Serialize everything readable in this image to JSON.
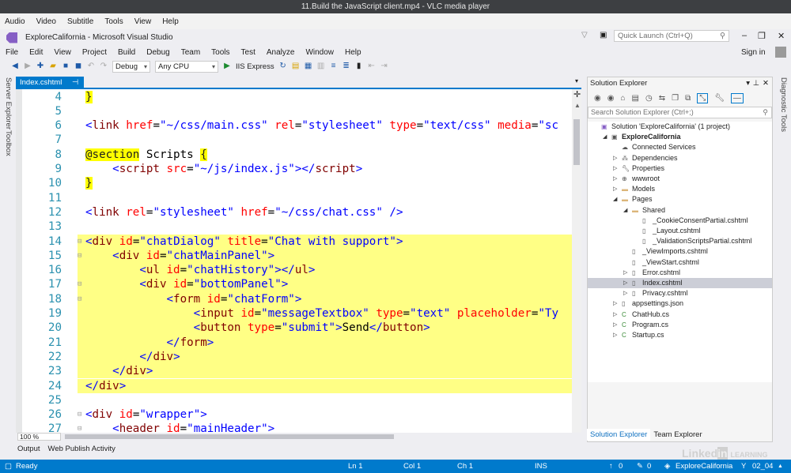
{
  "vlc": {
    "title": "11.Build the JavaScript client.mp4 - VLC media player",
    "menu": [
      "Audio",
      "Video",
      "Subtitle",
      "Tools",
      "View",
      "Help"
    ]
  },
  "vs": {
    "title": "ExploreCalifornia - Microsoft Visual Studio",
    "quick_launch_placeholder": "Quick Launch (Ctrl+Q)",
    "sign_in": "Sign in",
    "menu": [
      "File",
      "Edit",
      "View",
      "Project",
      "Build",
      "Debug",
      "Team",
      "Tools",
      "Test",
      "Analyze",
      "Window",
      "Help"
    ],
    "toolbar": {
      "config": "Debug",
      "platform": "Any CPU",
      "run": "IIS Express"
    }
  },
  "left_strip": [
    "Server Explorer",
    "Toolbox"
  ],
  "right_strip": [
    "Diagnostic Tools"
  ],
  "editor": {
    "tab": "Index.cshtml",
    "zoom": "100 %",
    "lines": [
      {
        "n": "4",
        "t": [
          [
            "br",
            "}"
          ]
        ]
      },
      {
        "n": "5",
        "t": []
      },
      {
        "n": "6",
        "t": [
          [
            "tag",
            "<"
          ],
          [
            "el",
            "link "
          ],
          [
            "at",
            "href"
          ],
          [
            "d",
            "="
          ],
          [
            "st",
            "\"~/css/main.css\" "
          ],
          [
            "at",
            "rel"
          ],
          [
            "d",
            "="
          ],
          [
            "st",
            "\"stylesheet\" "
          ],
          [
            "at",
            "type"
          ],
          [
            "d",
            "="
          ],
          [
            "st",
            "\"text/css\" "
          ],
          [
            "at",
            "media"
          ],
          [
            "d",
            "="
          ],
          [
            "st",
            "\"sc"
          ]
        ]
      },
      {
        "n": "7",
        "t": []
      },
      {
        "n": "8",
        "t": [
          [
            "br",
            "@section"
          ],
          [
            "d",
            " Scripts "
          ],
          [
            "br",
            "{"
          ]
        ]
      },
      {
        "n": "9",
        "t": [
          [
            "d",
            "    "
          ],
          [
            "tag",
            "<"
          ],
          [
            "el",
            "script "
          ],
          [
            "at",
            "src"
          ],
          [
            "d",
            "="
          ],
          [
            "st",
            "\"~/js/index.js\""
          ],
          [
            "tag",
            "></"
          ],
          [
            "el",
            "script"
          ],
          [
            "tag",
            ">"
          ]
        ]
      },
      {
        "n": "10",
        "t": [
          [
            "br",
            "}"
          ]
        ]
      },
      {
        "n": "11",
        "t": []
      },
      {
        "n": "12",
        "t": [
          [
            "tag",
            "<"
          ],
          [
            "el",
            "link "
          ],
          [
            "at",
            "rel"
          ],
          [
            "d",
            "="
          ],
          [
            "st",
            "\"stylesheet\" "
          ],
          [
            "at",
            "href"
          ],
          [
            "d",
            "="
          ],
          [
            "st",
            "\"~/css/chat.css\" "
          ],
          [
            "tag",
            "/>"
          ]
        ]
      },
      {
        "n": "13",
        "t": []
      },
      {
        "n": "14",
        "hl": true,
        "f": "⊟",
        "t": [
          [
            "tag",
            "<"
          ],
          [
            "el",
            "div "
          ],
          [
            "at",
            "id"
          ],
          [
            "d",
            "="
          ],
          [
            "st",
            "\"chatDialog\" "
          ],
          [
            "at",
            "title"
          ],
          [
            "d",
            "="
          ],
          [
            "st",
            "\"Chat with support\""
          ],
          [
            "tag",
            ">"
          ]
        ]
      },
      {
        "n": "15",
        "hl": true,
        "f": "⊟",
        "t": [
          [
            "d",
            "    "
          ],
          [
            "tag",
            "<"
          ],
          [
            "el",
            "div "
          ],
          [
            "at",
            "id"
          ],
          [
            "d",
            "="
          ],
          [
            "st",
            "\"chatMainPanel\""
          ],
          [
            "tag",
            ">"
          ]
        ]
      },
      {
        "n": "16",
        "hl": true,
        "t": [
          [
            "d",
            "        "
          ],
          [
            "tag",
            "<"
          ],
          [
            "el",
            "ul "
          ],
          [
            "at",
            "id"
          ],
          [
            "d",
            "="
          ],
          [
            "st",
            "\"chatHistory\""
          ],
          [
            "tag",
            "></"
          ],
          [
            "el",
            "ul"
          ],
          [
            "tag",
            ">"
          ]
        ]
      },
      {
        "n": "17",
        "hl": true,
        "f": "⊟",
        "t": [
          [
            "d",
            "        "
          ],
          [
            "tag",
            "<"
          ],
          [
            "el",
            "div "
          ],
          [
            "at",
            "id"
          ],
          [
            "d",
            "="
          ],
          [
            "st",
            "\"bottomPanel\""
          ],
          [
            "tag",
            ">"
          ]
        ]
      },
      {
        "n": "18",
        "hl": true,
        "f": "⊟",
        "t": [
          [
            "d",
            "            "
          ],
          [
            "tag",
            "<"
          ],
          [
            "el",
            "form "
          ],
          [
            "at",
            "id"
          ],
          [
            "d",
            "="
          ],
          [
            "st",
            "\"chatForm\""
          ],
          [
            "tag",
            ">"
          ]
        ]
      },
      {
        "n": "19",
        "hl": true,
        "t": [
          [
            "d",
            "                "
          ],
          [
            "tag",
            "<"
          ],
          [
            "el",
            "input "
          ],
          [
            "at",
            "id"
          ],
          [
            "d",
            "="
          ],
          [
            "st",
            "\"messageTextbox\" "
          ],
          [
            "at",
            "type"
          ],
          [
            "d",
            "="
          ],
          [
            "st",
            "\"text\" "
          ],
          [
            "at",
            "placeholder"
          ],
          [
            "d",
            "="
          ],
          [
            "st",
            "\"Ty"
          ]
        ]
      },
      {
        "n": "20",
        "hl": true,
        "t": [
          [
            "d",
            "                "
          ],
          [
            "tag",
            "<"
          ],
          [
            "el",
            "button "
          ],
          [
            "at",
            "type"
          ],
          [
            "d",
            "="
          ],
          [
            "st",
            "\"submit\""
          ],
          [
            "tag",
            ">"
          ],
          [
            "d",
            "Send"
          ],
          [
            "tag",
            "</"
          ],
          [
            "el",
            "button"
          ],
          [
            "tag",
            ">"
          ]
        ]
      },
      {
        "n": "21",
        "hl": true,
        "t": [
          [
            "d",
            "            "
          ],
          [
            "tag",
            "</"
          ],
          [
            "el",
            "form"
          ],
          [
            "tag",
            ">"
          ]
        ]
      },
      {
        "n": "22",
        "hl": true,
        "t": [
          [
            "d",
            "        "
          ],
          [
            "tag",
            "</"
          ],
          [
            "el",
            "div"
          ],
          [
            "tag",
            ">"
          ]
        ]
      },
      {
        "n": "23",
        "hl": true,
        "t": [
          [
            "d",
            "    "
          ],
          [
            "tag",
            "</"
          ],
          [
            "el",
            "div"
          ],
          [
            "tag",
            ">"
          ]
        ]
      },
      {
        "n": "24",
        "hl": true,
        "t": [
          [
            "tag",
            "</"
          ],
          [
            "el",
            "div"
          ],
          [
            "tag",
            ">"
          ]
        ]
      },
      {
        "n": "25",
        "t": []
      },
      {
        "n": "26",
        "f": "⊟",
        "t": [
          [
            "tag",
            "<"
          ],
          [
            "el",
            "div "
          ],
          [
            "at",
            "id"
          ],
          [
            "d",
            "="
          ],
          [
            "st",
            "\"wrapper\""
          ],
          [
            "tag",
            ">"
          ]
        ]
      },
      {
        "n": "27",
        "f": "⊟",
        "t": [
          [
            "d",
            "    "
          ],
          [
            "tag",
            "<"
          ],
          [
            "el",
            "header "
          ],
          [
            "at",
            "id"
          ],
          [
            "d",
            "="
          ],
          [
            "st",
            "\"mainHeader\""
          ],
          [
            "tag",
            ">"
          ]
        ]
      }
    ]
  },
  "output_tabs": [
    "Output",
    "Web Publish Activity"
  ],
  "solution_explorer": {
    "title": "Solution Explorer",
    "search_placeholder": "Search Solution Explorer (Ctrl+;)",
    "tree": [
      {
        "label": "Solution 'ExploreCalifornia' (1 project)",
        "depth": 0,
        "icon": "solution-icon"
      },
      {
        "label": "ExploreCalifornia",
        "depth": 1,
        "expanded": true,
        "bold": true,
        "icon": "project-icon"
      },
      {
        "label": "Connected Services",
        "depth": 2,
        "icon": "cloud-icon"
      },
      {
        "label": "Dependencies",
        "depth": 2,
        "expanded": false,
        "icon": "dependencies-icon"
      },
      {
        "label": "Properties",
        "depth": 2,
        "expanded": false,
        "icon": "wrench-icon"
      },
      {
        "label": "wwwroot",
        "depth": 2,
        "expanded": false,
        "icon": "globe-icon"
      },
      {
        "label": "Models",
        "depth": 2,
        "expanded": false,
        "icon": "folder-icon"
      },
      {
        "label": "Pages",
        "depth": 2,
        "expanded": true,
        "icon": "folder-icon"
      },
      {
        "label": "Shared",
        "depth": 3,
        "expanded": true,
        "icon": "folder-icon"
      },
      {
        "label": "_CookieConsentPartial.cshtml",
        "depth": 4,
        "icon": "file-icon"
      },
      {
        "label": "_Layout.cshtml",
        "depth": 4,
        "icon": "file-icon"
      },
      {
        "label": "_ValidationScriptsPartial.cshtml",
        "depth": 4,
        "icon": "file-icon"
      },
      {
        "label": "_ViewImports.cshtml",
        "depth": 3,
        "icon": "file-icon"
      },
      {
        "label": "_ViewStart.cshtml",
        "depth": 3,
        "icon": "file-icon"
      },
      {
        "label": "Error.cshtml",
        "depth": 3,
        "expanded": false,
        "icon": "file-icon"
      },
      {
        "label": "Index.cshtml",
        "depth": 3,
        "expanded": false,
        "selected": true,
        "icon": "file-icon"
      },
      {
        "label": "Privacy.cshtml",
        "depth": 3,
        "expanded": false,
        "icon": "file-icon"
      },
      {
        "label": "appsettings.json",
        "depth": 2,
        "expanded": false,
        "icon": "json-icon"
      },
      {
        "label": "ChatHub.cs",
        "depth": 2,
        "expanded": false,
        "icon": "csharp-icon"
      },
      {
        "label": "Program.cs",
        "depth": 2,
        "expanded": false,
        "icon": "csharp-icon"
      },
      {
        "label": "Startup.cs",
        "depth": 2,
        "expanded": false,
        "icon": "csharp-icon"
      }
    ],
    "tabs": [
      "Solution Explorer",
      "Team Explorer"
    ]
  },
  "status": {
    "ready": "Ready",
    "ln": "Ln 1",
    "col": "Col 1",
    "ch": "Ch 1",
    "mode": "INS",
    "up": "0",
    "edits": "0",
    "repo": "ExploreCalifornia",
    "branch": "02_04"
  },
  "watermark": "LinkedIn Learning",
  "colors": {
    "accent": "#007acc",
    "highlight": "#ffff85"
  }
}
